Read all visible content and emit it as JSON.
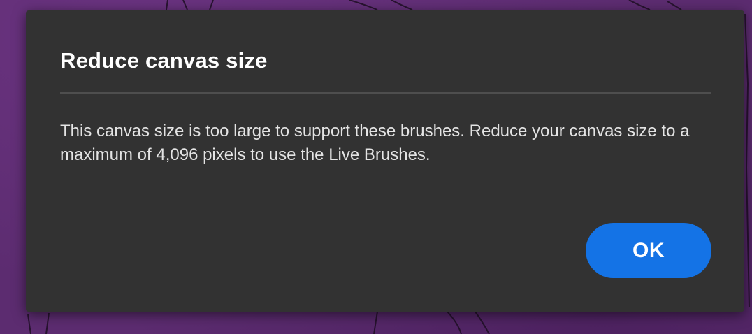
{
  "background": {
    "color": "#5c2c70"
  },
  "dialog": {
    "title": "Reduce canvas size",
    "message": "This canvas size is too large to support these brushes. Reduce your canvas size to a maximum of 4,096 pixels to use the Live Brushes.",
    "ok_label": "OK",
    "background_color": "#323232",
    "accent_color": "#1473e6"
  }
}
